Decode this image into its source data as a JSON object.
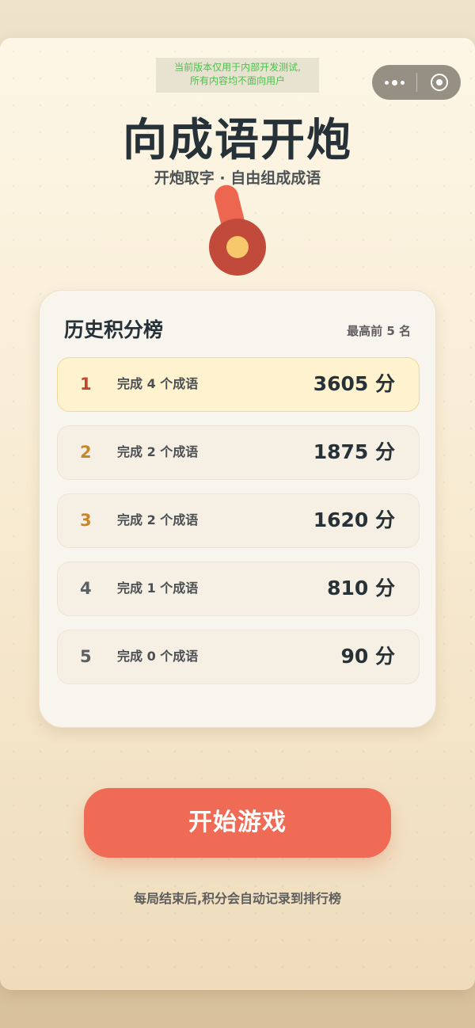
{
  "dev_banner": {
    "line1": "当前版本仅用于内部开发测试,",
    "line2": "所有内容均不面向用户"
  },
  "header": {
    "title": "向成语开炮",
    "subtitle": "开炮取字 · 自由组成成语"
  },
  "capsule": {
    "more_icon": "more-dots-icon",
    "close_icon": "target-close-icon"
  },
  "leaderboard": {
    "title": "历史积分榜",
    "hint": "最高前 5 名",
    "rows": [
      {
        "rank": "1",
        "count": "完成 4 个成语",
        "score": "3605 分",
        "rank_color": "#c0462e"
      },
      {
        "rank": "2",
        "count": "完成 2 个成语",
        "score": "1875 分",
        "rank_color": "#c8862a"
      },
      {
        "rank": "3",
        "count": "完成 2 个成语",
        "score": "1620 分",
        "rank_color": "#c8862a"
      },
      {
        "rank": "4",
        "count": "完成 1 个成语",
        "score": "810 分",
        "rank_color": "#5a5f63"
      },
      {
        "rank": "5",
        "count": "完成 0 个成语",
        "score": "90 分",
        "rank_color": "#5a5f63"
      }
    ]
  },
  "actions": {
    "start_label": "开始游戏"
  },
  "footer": {
    "note": "每局结束后,积分会自动记录到排行榜"
  },
  "colors": {
    "accent": "#ef6b55",
    "highlight_row": "#fff3cf",
    "title_text": "#263238"
  }
}
